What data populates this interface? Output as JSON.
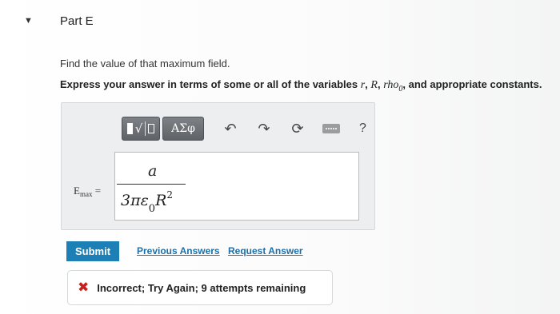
{
  "part": {
    "chevron_icon": "triangle-down-icon",
    "title": "Part E"
  },
  "question": {
    "prompt": "Find the value of that maximum field.",
    "instruction_prefix": "Express your answer in terms of some or all of the variables ",
    "var_r": "r",
    "var_R": "R",
    "var_rho": "rho",
    "var_rho_sub": "0",
    "instruction_suffix": ", and appropriate constants."
  },
  "toolbar": {
    "templates_icon": "templates-radical-icon",
    "templates_glyph": "√",
    "greek_label": "ΑΣφ",
    "undo_icon": "undo-icon",
    "undo_glyph": "↶",
    "redo_icon": "redo-icon",
    "redo_glyph": "↷",
    "reset_icon": "reset-icon",
    "reset_glyph": "⟳",
    "keyboard_icon": "keyboard-icon",
    "help_label": "?"
  },
  "answer": {
    "label_main": "E",
    "label_sub": "max",
    "label_eq": " =",
    "numerator": "a",
    "denominator_main": "3πε",
    "denominator_sub": "0",
    "denominator_var": "R",
    "denominator_exp": "2"
  },
  "actions": {
    "submit_label": "Submit",
    "previous_answers_label": "Previous Answers",
    "request_answer_label": "Request Answer"
  },
  "feedback": {
    "icon": "x-mark-icon",
    "glyph": "✖",
    "text": "Incorrect; Try Again; 9 attempts remaining",
    "color": "#c81f1f"
  },
  "colors": {
    "submit": "#1c7fb5",
    "link": "#1f6fa6",
    "toolbar": "#6d7074"
  }
}
